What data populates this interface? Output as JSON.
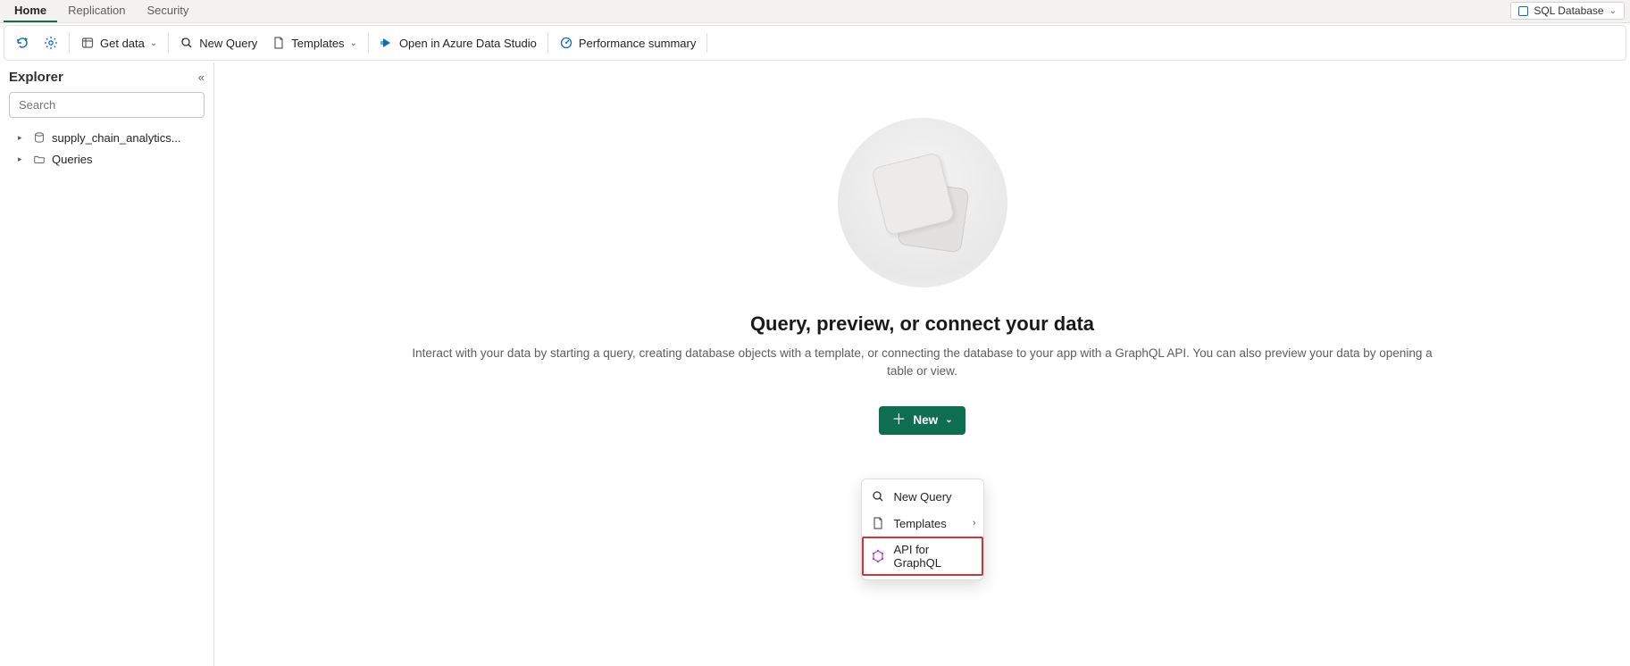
{
  "tabs": {
    "home": "Home",
    "replication": "Replication",
    "security": "Security"
  },
  "db_badge": "SQL Database",
  "toolbar": {
    "get_data": "Get data",
    "new_query": "New Query",
    "templates": "Templates",
    "open_ads": "Open in Azure Data Studio",
    "perf": "Performance summary"
  },
  "sidebar": {
    "title": "Explorer",
    "search_placeholder": "Search",
    "items": [
      "supply_chain_analytics...",
      "Queries"
    ]
  },
  "empty": {
    "title": "Query, preview, or connect your data",
    "subtitle": "Interact with your data by starting a query, creating database objects with a template, or connecting the database to your app with a GraphQL API. You can also preview your data by opening a table or view."
  },
  "new_button": "New",
  "menu": {
    "new_query": "New Query",
    "templates": "Templates",
    "graphql": "API for GraphQL"
  }
}
